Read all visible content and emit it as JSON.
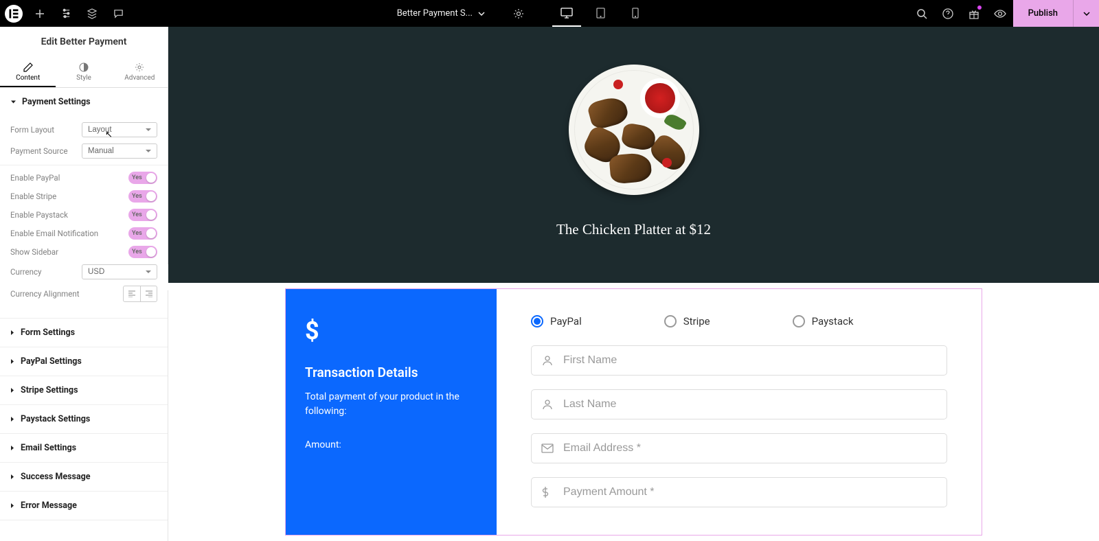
{
  "topbar": {
    "doc_title": "Better Payment S...",
    "publish": "Publish"
  },
  "sidebar": {
    "header": "Edit Better Payment",
    "tabs": {
      "content": "Content",
      "style": "Style",
      "advanced": "Advanced"
    },
    "section_payment": "Payment Settings",
    "form_layout": {
      "label": "Form Layout",
      "value": "Layout"
    },
    "payment_source": {
      "label": "Payment Source",
      "value": "Manual"
    },
    "toggles": {
      "enable_paypal": {
        "label": "Enable PayPal",
        "value": "Yes"
      },
      "enable_stripe": {
        "label": "Enable Stripe",
        "value": "Yes"
      },
      "enable_paystack": {
        "label": "Enable Paystack",
        "value": "Yes"
      },
      "enable_email": {
        "label": "Enable Email Notification",
        "value": "Yes"
      },
      "show_sidebar": {
        "label": "Show Sidebar",
        "value": "Yes"
      }
    },
    "currency": {
      "label": "Currency",
      "value": "USD"
    },
    "currency_align": "Currency Alignment",
    "collapsed": {
      "form": "Form Settings",
      "paypal": "PayPal Settings",
      "stripe": "Stripe Settings",
      "paystack": "Paystack Settings",
      "email": "Email Settings",
      "success": "Success Message",
      "error": "Error Message"
    }
  },
  "preview": {
    "hero_title": "The Chicken Platter at $12",
    "sidebar": {
      "dollar": "$",
      "trans_title": "Transaction Details",
      "trans_desc": "Total payment of your product in the following:",
      "amount_label": "Amount:"
    },
    "methods": {
      "paypal": "PayPal",
      "stripe": "Stripe",
      "paystack": "Paystack"
    },
    "placeholders": {
      "first_name": "First Name",
      "last_name": "Last Name",
      "email": "Email Address *",
      "amount": "Payment Amount *"
    }
  }
}
